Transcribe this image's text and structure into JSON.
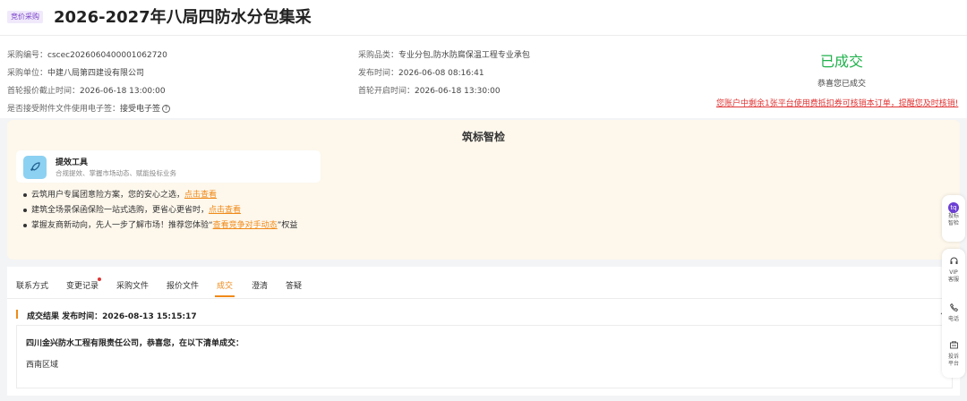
{
  "header": {
    "badge": "竞价采购",
    "title": "2026-2027年八局四防水分包集采"
  },
  "info": {
    "left": [
      {
        "label": "采购编号：",
        "value": "cscec2026060400001062720"
      },
      {
        "label": "采购单位：",
        "value": "中建八局第四建设有限公司"
      },
      {
        "label": "首轮报价截止时间：",
        "value": "2026-06-18 13:00:00"
      },
      {
        "label": "是否接受附件文件使用电子签：",
        "value": "接受电子签"
      }
    ],
    "middle": [
      {
        "label": "采购品类：",
        "value": "专业分包,防水防腐保温工程专业承包"
      },
      {
        "label": "发布时间：",
        "value": "2026-06-08 08:16:41"
      },
      {
        "label": "首轮开启时间：",
        "value": "2026-06-18 13:30:00"
      }
    ],
    "help_icon": "?"
  },
  "status": {
    "main": "已成交",
    "sub": "恭喜您已成交",
    "warning": "您账户中剩余1张平台使用费抵扣券可核销本订单，提醒您及时核销!",
    "main_color": "#20b24c",
    "warning_color": "#e03434"
  },
  "smart": {
    "title": "筑标智检",
    "tool_name": "提效工具",
    "tool_desc": "合规提效、掌握市场动态、赋能投标业务",
    "tool_icon": "rocket-icon",
    "tips": [
      {
        "text": "云筑用户专属团意险方案，您的安心之选，",
        "link": "点击查看",
        "after": ""
      },
      {
        "text": "建筑全场景保函保险一站式选购，更省心更省时，",
        "link": "点击查看",
        "after": ""
      },
      {
        "text": "掌握友商新动向，先人一步了解市场！推荐您体验“",
        "link": "查看竞争对手动态",
        "after": "”权益"
      }
    ]
  },
  "tabs": [
    "联系方式",
    "变更记录",
    "采购文件",
    "报价文件",
    "成交",
    "澄清",
    "答疑"
  ],
  "active_tab": "成交",
  "accent_color": "#f08a19",
  "result": {
    "heading": "成交结果  发布时间：2026-08-13 15:15:17",
    "winner": "四川金兴防水工程有限责任公司，恭喜您，在以下清单成交：",
    "region": "西南区域"
  },
  "float": {
    "top_icon": "tq",
    "top_label_1": "投标",
    "top_label_2": "智检",
    "items": [
      {
        "icon": "headset-icon",
        "l1": "VIP",
        "l2": "客服"
      },
      {
        "icon": "phone-icon",
        "l1": "电话",
        "l2": ""
      },
      {
        "icon": "complaint-icon",
        "l1": "投诉",
        "l2": "平台"
      }
    ]
  }
}
